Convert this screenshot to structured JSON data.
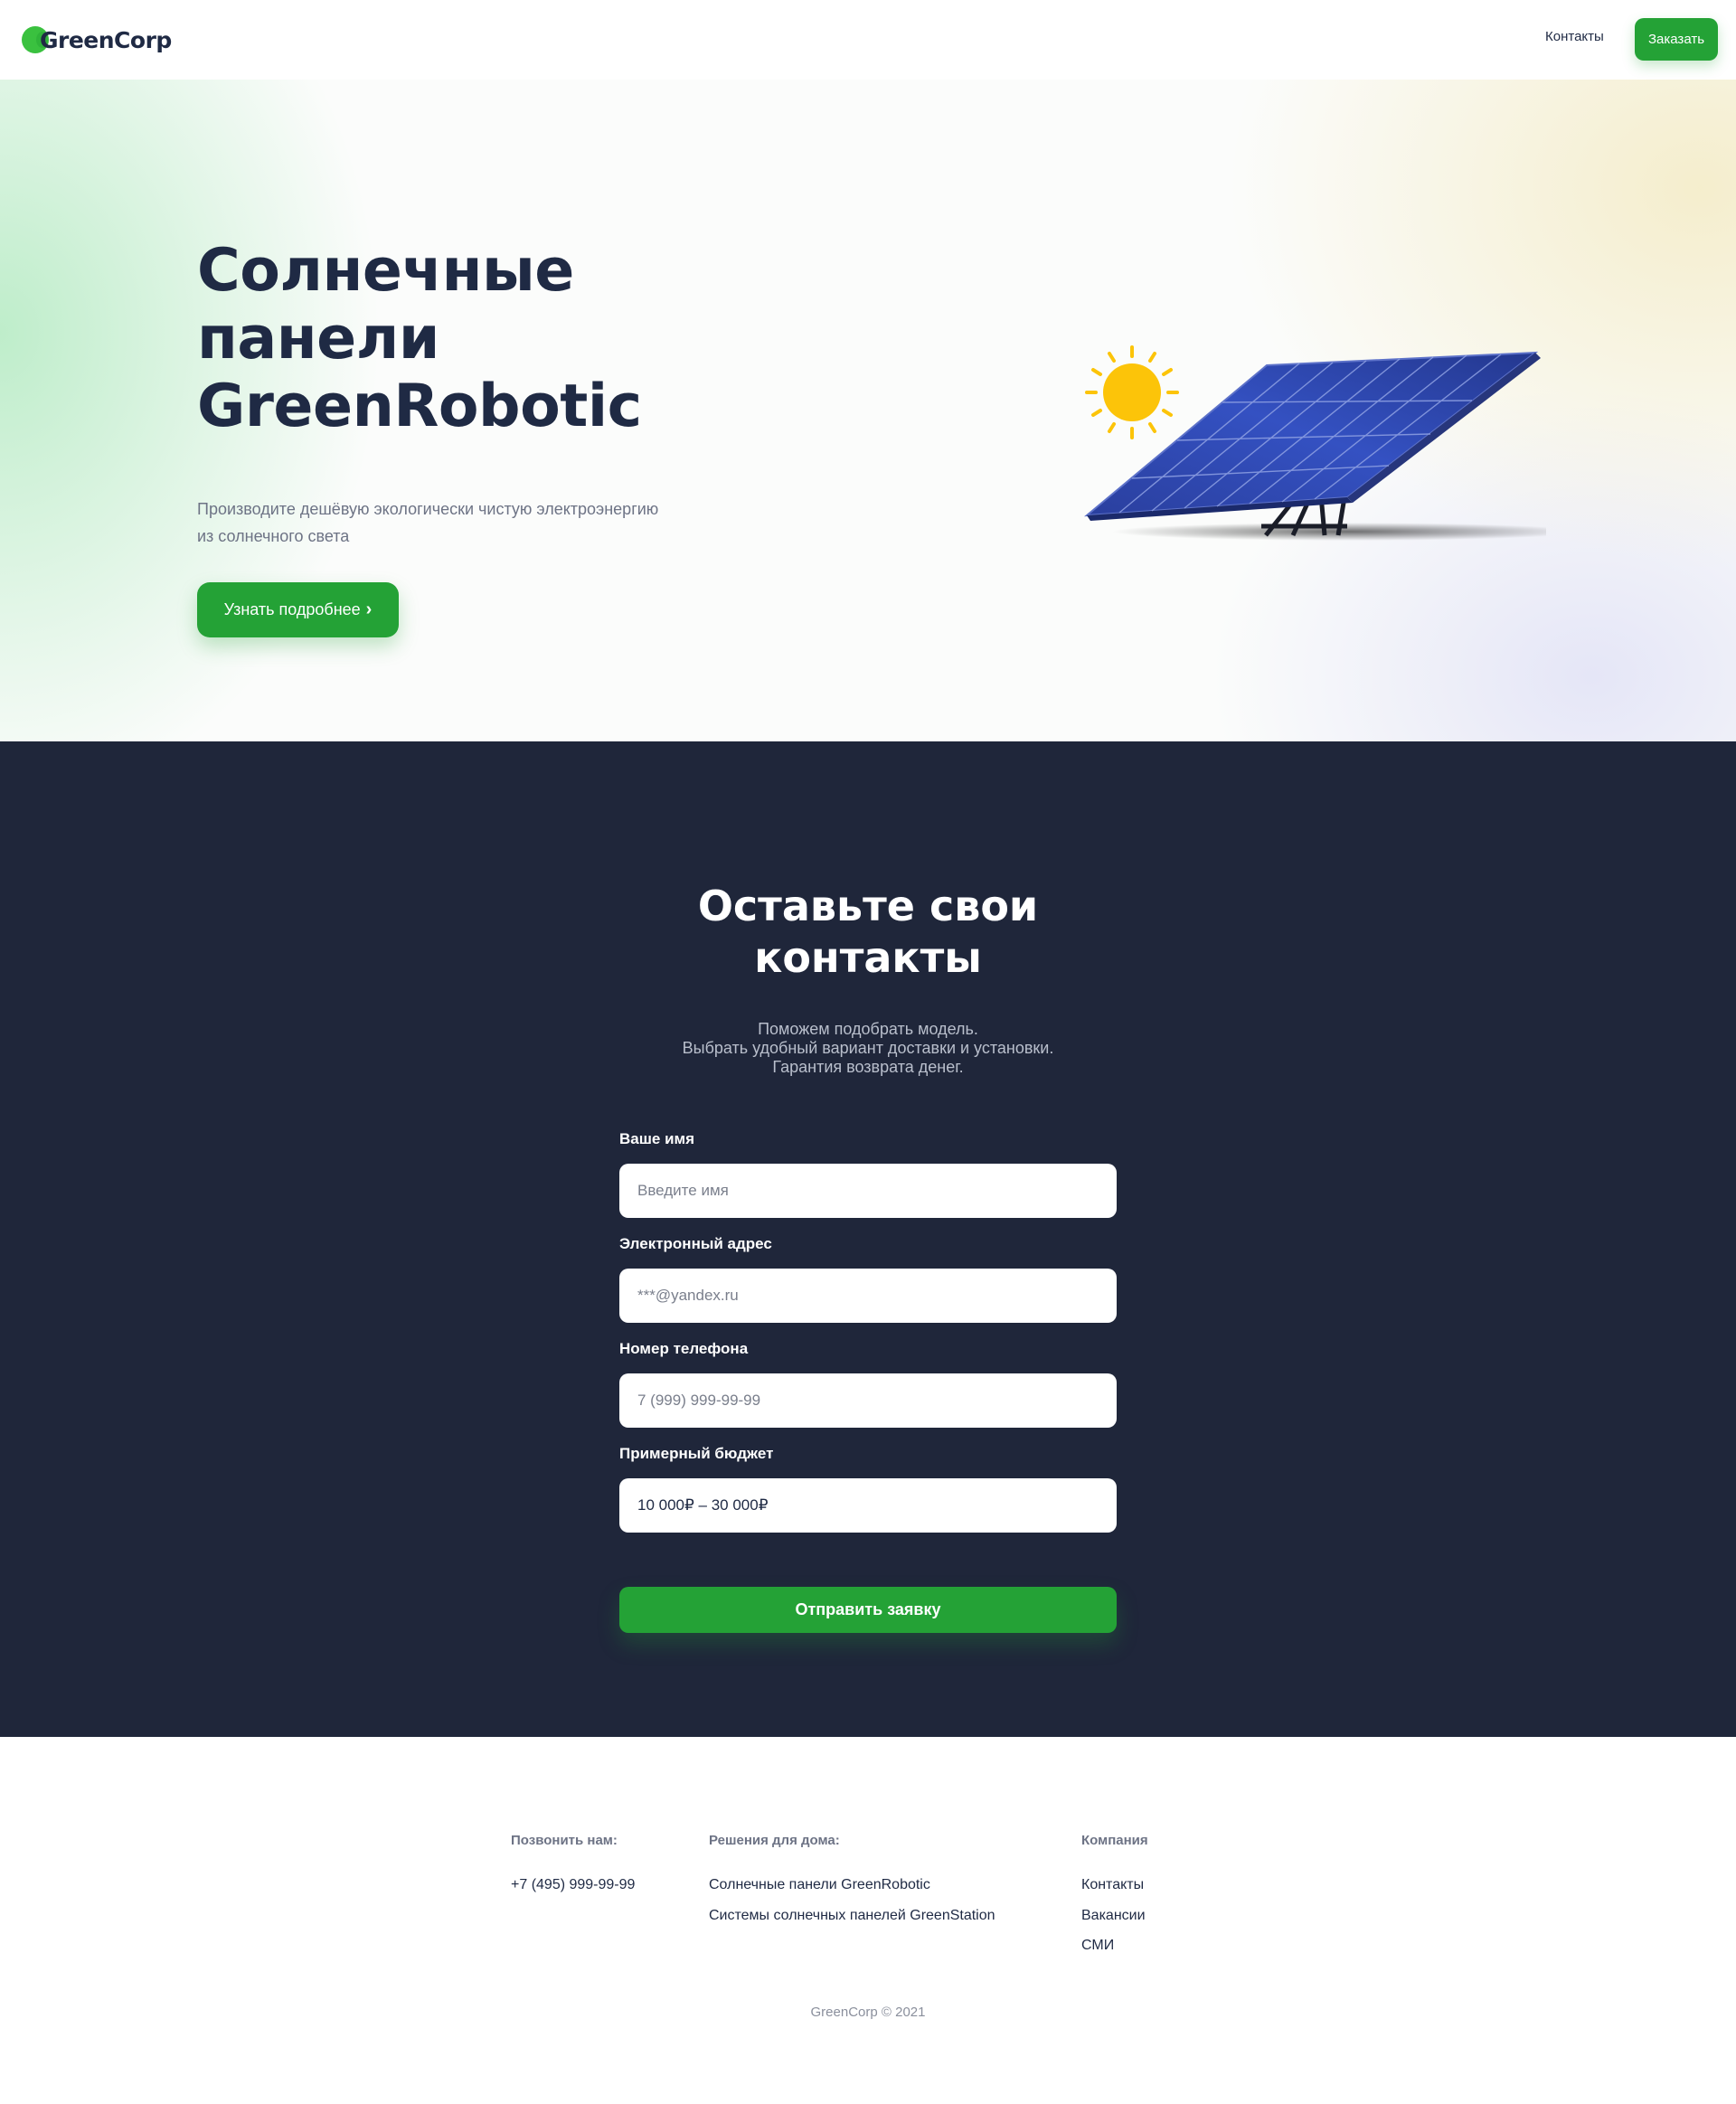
{
  "header": {
    "logo": "GreenCorp",
    "nav_contacts": "Контакты",
    "order_label": "Заказать"
  },
  "hero": {
    "title_line1": "Солнечные",
    "title_line2": "панели",
    "title_line3": "GreenRobotic",
    "subtitle_line1": "Производите дешёвую экологически чистую электроэнергию",
    "subtitle_line2": "из солнечного света",
    "cta_label": "Узнать подробнее"
  },
  "contact": {
    "title_line1": "Оставьте свои",
    "title_line2": "контакты",
    "sub_line1": "Поможем подобрать модель.",
    "sub_line2": "Выбрать удобный вариант доставки и установки.",
    "sub_line3": "Гарантия возврата денег.",
    "fields": [
      {
        "label": "Ваше имя",
        "placeholder": "Введите имя",
        "value": ""
      },
      {
        "label": "Электронный адрес",
        "placeholder": "***@yandex.ru",
        "value": ""
      },
      {
        "label": "Номер телефона",
        "placeholder": "7 (999) 999-99-99",
        "value": ""
      },
      {
        "label": "Примерный бюджет",
        "placeholder": "",
        "value": "10 000₽ – 30 000₽"
      }
    ],
    "submit_label": "Отправить заявку"
  },
  "footer": {
    "col1_heading": "Позвонить нам:",
    "phone": "+7 (495) 999-99-99",
    "col2_heading": "Решения для дома:",
    "col2_links": [
      "Солнечные панели GreenRobotic",
      "Системы солнечных панелей GreenStation"
    ],
    "col3_heading": "Компания",
    "col3_links": [
      "Контакты",
      "Вакансии",
      "СМИ"
    ],
    "copyright": "GreenCorp © 2021"
  },
  "colors": {
    "accent": "#24a236",
    "dark": "#1f263a",
    "text": "#1f2a44",
    "sun": "#fcc409"
  },
  "icons": {
    "logo_mark": "green-circle-logo-icon",
    "cta_arrow": "chevron-right-icon",
    "illustration": "solar-panel-with-sun"
  }
}
